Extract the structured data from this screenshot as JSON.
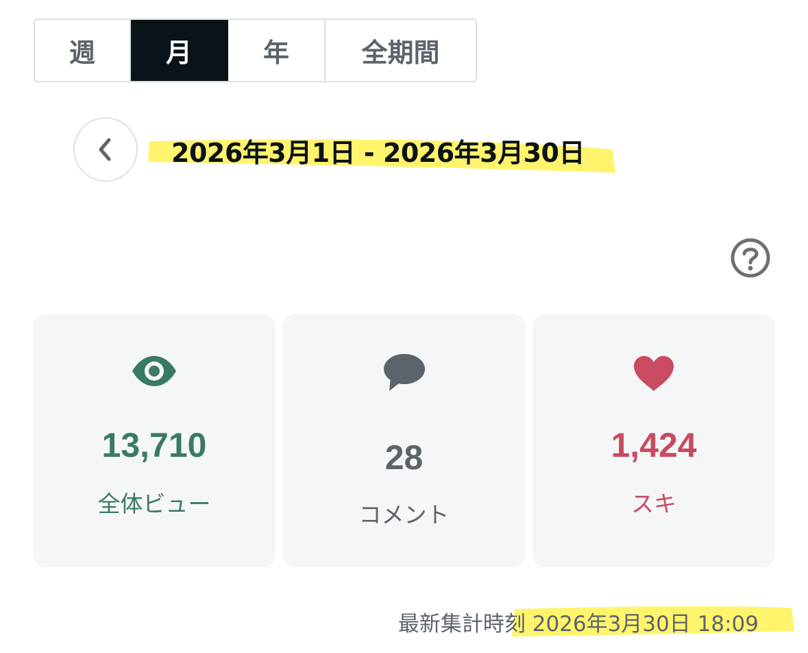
{
  "period_tabs": [
    {
      "label": "週",
      "active": false
    },
    {
      "label": "月",
      "active": true
    },
    {
      "label": "年",
      "active": false
    },
    {
      "label": "全期間",
      "active": false
    }
  ],
  "date_range": "2026年3月1日 - 2026年3月30日",
  "stats": {
    "views": {
      "value": "13,710",
      "label": "全体ビュー",
      "icon": "eye-icon",
      "color": "#3a7a63"
    },
    "comments": {
      "value": "28",
      "label": "コメント",
      "icon": "speech-bubble-icon",
      "color": "#5c636b"
    },
    "likes": {
      "value": "1,424",
      "label": "スキ",
      "icon": "heart-icon",
      "color": "#c84b61"
    }
  },
  "updated": {
    "label": "最新集計時刻",
    "timestamp": "2026年3月30日 18:09"
  },
  "colors": {
    "tab_active_bg": "#0b1319",
    "card_bg": "#f5f6f8",
    "highlight": "#fff35c"
  }
}
